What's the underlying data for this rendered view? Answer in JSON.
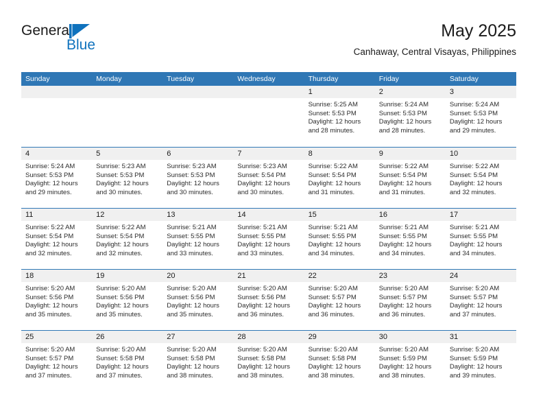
{
  "brand": {
    "name_part1": "General",
    "name_part2": "Blue",
    "flag_color": "#0f72bd"
  },
  "header": {
    "title": "May 2025",
    "subtitle": "Canhaway, Central Visayas, Philippines"
  },
  "colors": {
    "header_blue": "#2f77b5",
    "day_band_gray": "#f0f0f0",
    "text": "#1a1a1a"
  },
  "weekdays": [
    "Sunday",
    "Monday",
    "Tuesday",
    "Wednesday",
    "Thursday",
    "Friday",
    "Saturday"
  ],
  "weeks": [
    [
      {
        "day": "",
        "sunrise": "",
        "sunset": "",
        "daylight_line1": "",
        "daylight_line2": ""
      },
      {
        "day": "",
        "sunrise": "",
        "sunset": "",
        "daylight_line1": "",
        "daylight_line2": ""
      },
      {
        "day": "",
        "sunrise": "",
        "sunset": "",
        "daylight_line1": "",
        "daylight_line2": ""
      },
      {
        "day": "",
        "sunrise": "",
        "sunset": "",
        "daylight_line1": "",
        "daylight_line2": ""
      },
      {
        "day": "1",
        "sunrise": "Sunrise: 5:25 AM",
        "sunset": "Sunset: 5:53 PM",
        "daylight_line1": "Daylight: 12 hours",
        "daylight_line2": "and 28 minutes."
      },
      {
        "day": "2",
        "sunrise": "Sunrise: 5:24 AM",
        "sunset": "Sunset: 5:53 PM",
        "daylight_line1": "Daylight: 12 hours",
        "daylight_line2": "and 28 minutes."
      },
      {
        "day": "3",
        "sunrise": "Sunrise: 5:24 AM",
        "sunset": "Sunset: 5:53 PM",
        "daylight_line1": "Daylight: 12 hours",
        "daylight_line2": "and 29 minutes."
      }
    ],
    [
      {
        "day": "4",
        "sunrise": "Sunrise: 5:24 AM",
        "sunset": "Sunset: 5:53 PM",
        "daylight_line1": "Daylight: 12 hours",
        "daylight_line2": "and 29 minutes."
      },
      {
        "day": "5",
        "sunrise": "Sunrise: 5:23 AM",
        "sunset": "Sunset: 5:53 PM",
        "daylight_line1": "Daylight: 12 hours",
        "daylight_line2": "and 30 minutes."
      },
      {
        "day": "6",
        "sunrise": "Sunrise: 5:23 AM",
        "sunset": "Sunset: 5:53 PM",
        "daylight_line1": "Daylight: 12 hours",
        "daylight_line2": "and 30 minutes."
      },
      {
        "day": "7",
        "sunrise": "Sunrise: 5:23 AM",
        "sunset": "Sunset: 5:54 PM",
        "daylight_line1": "Daylight: 12 hours",
        "daylight_line2": "and 30 minutes."
      },
      {
        "day": "8",
        "sunrise": "Sunrise: 5:22 AM",
        "sunset": "Sunset: 5:54 PM",
        "daylight_line1": "Daylight: 12 hours",
        "daylight_line2": "and 31 minutes."
      },
      {
        "day": "9",
        "sunrise": "Sunrise: 5:22 AM",
        "sunset": "Sunset: 5:54 PM",
        "daylight_line1": "Daylight: 12 hours",
        "daylight_line2": "and 31 minutes."
      },
      {
        "day": "10",
        "sunrise": "Sunrise: 5:22 AM",
        "sunset": "Sunset: 5:54 PM",
        "daylight_line1": "Daylight: 12 hours",
        "daylight_line2": "and 32 minutes."
      }
    ],
    [
      {
        "day": "11",
        "sunrise": "Sunrise: 5:22 AM",
        "sunset": "Sunset: 5:54 PM",
        "daylight_line1": "Daylight: 12 hours",
        "daylight_line2": "and 32 minutes."
      },
      {
        "day": "12",
        "sunrise": "Sunrise: 5:22 AM",
        "sunset": "Sunset: 5:54 PM",
        "daylight_line1": "Daylight: 12 hours",
        "daylight_line2": "and 32 minutes."
      },
      {
        "day": "13",
        "sunrise": "Sunrise: 5:21 AM",
        "sunset": "Sunset: 5:55 PM",
        "daylight_line1": "Daylight: 12 hours",
        "daylight_line2": "and 33 minutes."
      },
      {
        "day": "14",
        "sunrise": "Sunrise: 5:21 AM",
        "sunset": "Sunset: 5:55 PM",
        "daylight_line1": "Daylight: 12 hours",
        "daylight_line2": "and 33 minutes."
      },
      {
        "day": "15",
        "sunrise": "Sunrise: 5:21 AM",
        "sunset": "Sunset: 5:55 PM",
        "daylight_line1": "Daylight: 12 hours",
        "daylight_line2": "and 34 minutes."
      },
      {
        "day": "16",
        "sunrise": "Sunrise: 5:21 AM",
        "sunset": "Sunset: 5:55 PM",
        "daylight_line1": "Daylight: 12 hours",
        "daylight_line2": "and 34 minutes."
      },
      {
        "day": "17",
        "sunrise": "Sunrise: 5:21 AM",
        "sunset": "Sunset: 5:55 PM",
        "daylight_line1": "Daylight: 12 hours",
        "daylight_line2": "and 34 minutes."
      }
    ],
    [
      {
        "day": "18",
        "sunrise": "Sunrise: 5:20 AM",
        "sunset": "Sunset: 5:56 PM",
        "daylight_line1": "Daylight: 12 hours",
        "daylight_line2": "and 35 minutes."
      },
      {
        "day": "19",
        "sunrise": "Sunrise: 5:20 AM",
        "sunset": "Sunset: 5:56 PM",
        "daylight_line1": "Daylight: 12 hours",
        "daylight_line2": "and 35 minutes."
      },
      {
        "day": "20",
        "sunrise": "Sunrise: 5:20 AM",
        "sunset": "Sunset: 5:56 PM",
        "daylight_line1": "Daylight: 12 hours",
        "daylight_line2": "and 35 minutes."
      },
      {
        "day": "21",
        "sunrise": "Sunrise: 5:20 AM",
        "sunset": "Sunset: 5:56 PM",
        "daylight_line1": "Daylight: 12 hours",
        "daylight_line2": "and 36 minutes."
      },
      {
        "day": "22",
        "sunrise": "Sunrise: 5:20 AM",
        "sunset": "Sunset: 5:57 PM",
        "daylight_line1": "Daylight: 12 hours",
        "daylight_line2": "and 36 minutes."
      },
      {
        "day": "23",
        "sunrise": "Sunrise: 5:20 AM",
        "sunset": "Sunset: 5:57 PM",
        "daylight_line1": "Daylight: 12 hours",
        "daylight_line2": "and 36 minutes."
      },
      {
        "day": "24",
        "sunrise": "Sunrise: 5:20 AM",
        "sunset": "Sunset: 5:57 PM",
        "daylight_line1": "Daylight: 12 hours",
        "daylight_line2": "and 37 minutes."
      }
    ],
    [
      {
        "day": "25",
        "sunrise": "Sunrise: 5:20 AM",
        "sunset": "Sunset: 5:57 PM",
        "daylight_line1": "Daylight: 12 hours",
        "daylight_line2": "and 37 minutes."
      },
      {
        "day": "26",
        "sunrise": "Sunrise: 5:20 AM",
        "sunset": "Sunset: 5:58 PM",
        "daylight_line1": "Daylight: 12 hours",
        "daylight_line2": "and 37 minutes."
      },
      {
        "day": "27",
        "sunrise": "Sunrise: 5:20 AM",
        "sunset": "Sunset: 5:58 PM",
        "daylight_line1": "Daylight: 12 hours",
        "daylight_line2": "and 38 minutes."
      },
      {
        "day": "28",
        "sunrise": "Sunrise: 5:20 AM",
        "sunset": "Sunset: 5:58 PM",
        "daylight_line1": "Daylight: 12 hours",
        "daylight_line2": "and 38 minutes."
      },
      {
        "day": "29",
        "sunrise": "Sunrise: 5:20 AM",
        "sunset": "Sunset: 5:58 PM",
        "daylight_line1": "Daylight: 12 hours",
        "daylight_line2": "and 38 minutes."
      },
      {
        "day": "30",
        "sunrise": "Sunrise: 5:20 AM",
        "sunset": "Sunset: 5:59 PM",
        "daylight_line1": "Daylight: 12 hours",
        "daylight_line2": "and 38 minutes."
      },
      {
        "day": "31",
        "sunrise": "Sunrise: 5:20 AM",
        "sunset": "Sunset: 5:59 PM",
        "daylight_line1": "Daylight: 12 hours",
        "daylight_line2": "and 39 minutes."
      }
    ]
  ]
}
